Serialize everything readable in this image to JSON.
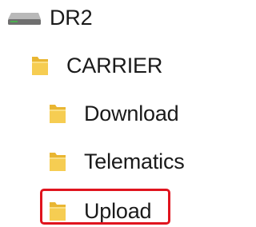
{
  "tree": {
    "drive": {
      "label": "DR2",
      "icon": "drive-icon"
    },
    "folders": [
      {
        "label": "CARRIER",
        "icon": "folder-icon"
      },
      {
        "label": "Download",
        "icon": "folder-icon"
      },
      {
        "label": "Telematics",
        "icon": "folder-icon"
      },
      {
        "label": "Upload",
        "icon": "folder-icon"
      }
    ]
  },
  "highlight": {
    "target": "Upload",
    "color": "#e0141e"
  },
  "colors": {
    "folder_main": "#f2c744",
    "folder_light": "#fadc7a",
    "drive_body": "#7a7a7a",
    "text": "#1a1a1a"
  }
}
